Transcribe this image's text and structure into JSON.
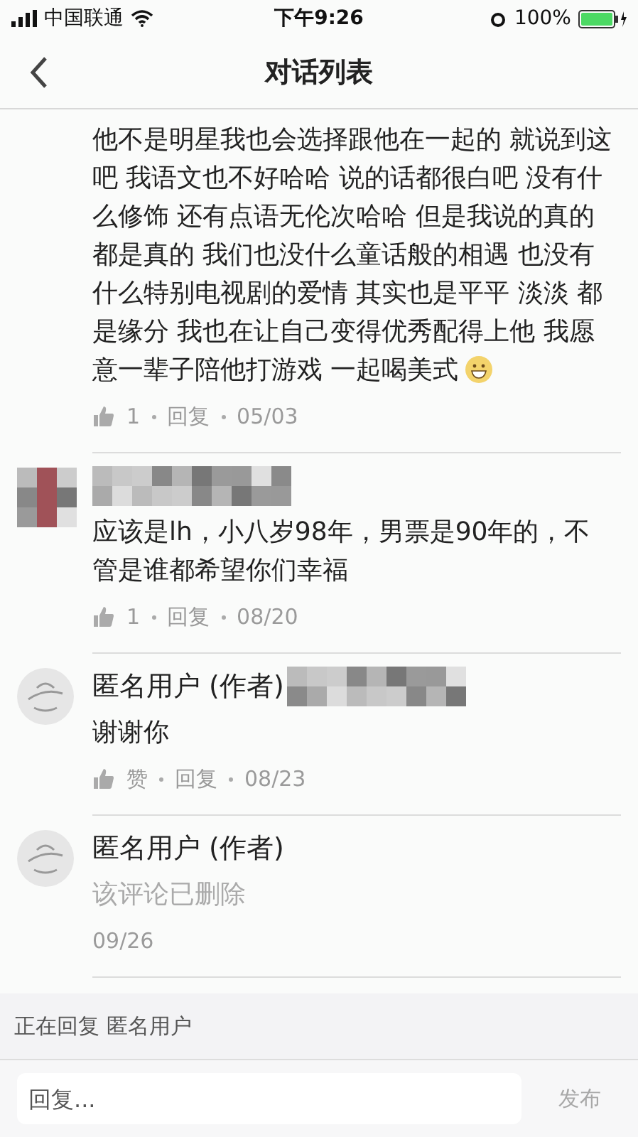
{
  "status_bar": {
    "carrier": "中国联通",
    "time": "下午9:26",
    "battery": "100%"
  },
  "nav": {
    "title": "对话列表"
  },
  "comments": [
    {
      "kind": "continued",
      "text": "他不是明星我也会选择跟他在一起的 就说到这吧 我语文也不好哈哈 说的话都很白吧 没有什么修饰 还有点语无伦次哈哈 但是我说的真的都是真的 我们也没什么童话般的相遇 也没有什么特别电视剧的爱情 其实也是平平 淡淡  都是缘分 我也在让自己变得优秀配得上他 我愿意一辈子陪他打游戏 一起喝美式",
      "emoji": true,
      "deleted": false,
      "likes": "1",
      "reply": "回复",
      "date": "05/03"
    },
    {
      "kind": "blurred",
      "name_blurred": true,
      "text": "应该是lh，小八岁98年，男票是90年的，不管是谁都希望你们幸福",
      "emoji": false,
      "deleted": false,
      "likes": "1",
      "reply": "回复",
      "date": "08/20"
    },
    {
      "kind": "author",
      "author": "匿名用户 (作者)",
      "name_blurred": true,
      "text": "谢谢你",
      "emoji": false,
      "deleted": false,
      "likes": "赞",
      "reply": "回复",
      "date": "08/23"
    },
    {
      "kind": "author",
      "author": "匿名用户 (作者)",
      "name_blurred": false,
      "text": "该评论已删除",
      "emoji": false,
      "deleted": true,
      "date": "09/26"
    }
  ],
  "reply_banner": "正在回复 匿名用户",
  "input": {
    "placeholder": "回复..."
  },
  "send": "发布"
}
